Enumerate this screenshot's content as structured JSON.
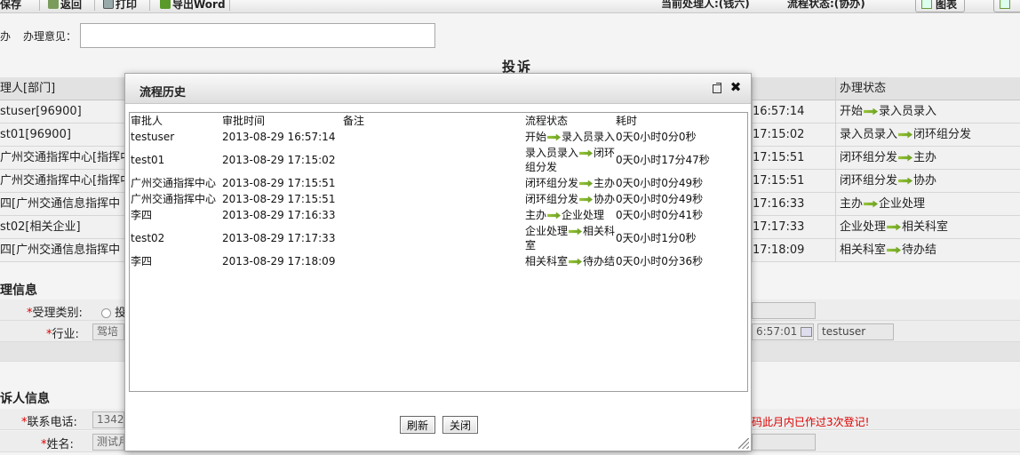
{
  "toolbar": {
    "save": "保存",
    "back": "返回",
    "print": "打印",
    "export_word": "导出Word",
    "current_handler": "当前处理人:(钱六)",
    "flow_status": "流程状态:(协办)",
    "chart": "图表"
  },
  "opinion": {
    "prefix": "办",
    "label": "办理意见："
  },
  "page_heading": "投诉",
  "bg_table": {
    "headers": [
      "理人[部门]",
      "",
      "办理状态"
    ],
    "rows": [
      {
        "handler": "stuser[96900]",
        "time": "16:57:14",
        "from": "开始",
        "to": "录入员录入"
      },
      {
        "handler": "st01[96900]",
        "time": "17:15:02",
        "from": "录入员录入",
        "to": "闭环组分发"
      },
      {
        "handler": "广州交通指挥中心[指挥中",
        "time": "17:15:51",
        "from": "闭环组分发",
        "to": "主办"
      },
      {
        "handler": "广州交通指挥中心[指挥中",
        "time": "17:15:51",
        "from": "闭环组分发",
        "to": "协办"
      },
      {
        "handler": "四[广州交通信息指挥中",
        "time": "17:16:33",
        "from": "主办",
        "to": "企业处理"
      },
      {
        "handler": "st02[相关企业]",
        "time": "17:17:33",
        "from": "企业处理",
        "to": "相关科室"
      },
      {
        "handler": "四[广州交通信息指挥中",
        "time": "17:18:09",
        "from": "相关科室",
        "to": "待办结"
      }
    ]
  },
  "accept_info": {
    "title": "理信息",
    "category_label": "受理类别:",
    "category_value": "投",
    "industry_label": "行业:",
    "industry_value": "驾培",
    "time_value": "6:57:01",
    "registrar_value": "testuser"
  },
  "complainant": {
    "title": "诉人信息",
    "phone_label": "联系电话:",
    "phone_value": "13422",
    "phone_warning": "码此月内已作过3次登记!",
    "name_label": "姓名:",
    "name_value": "测试月"
  },
  "dialog": {
    "title": "流程历史",
    "columns": [
      "审批人",
      "审批时间",
      "备注",
      "流程状态",
      "耗时"
    ],
    "rows": [
      {
        "approver": "testuser",
        "time": "2013-08-29 16:57:14",
        "remark": "",
        "from": "开始",
        "to": "录入员录入",
        "duration": "0天0小时0分0秒"
      },
      {
        "approver": "test01",
        "time": "2013-08-29 17:15:02",
        "remark": "",
        "from": "录入员录入",
        "to": "闭环组分发",
        "duration": "0天0小时17分47秒"
      },
      {
        "approver": "广州交通指挥中心",
        "time": "2013-08-29 17:15:51",
        "remark": "",
        "from": "闭环组分发",
        "to": "主办",
        "duration": "0天0小时0分49秒"
      },
      {
        "approver": "广州交通指挥中心",
        "time": "2013-08-29 17:15:51",
        "remark": "",
        "from": "闭环组分发",
        "to": "协办",
        "duration": "0天0小时0分49秒"
      },
      {
        "approver": "李四",
        "time": "2013-08-29 17:16:33",
        "remark": "",
        "from": "主办",
        "to": "企业处理",
        "duration": "0天0小时0分41秒"
      },
      {
        "approver": "test02",
        "time": "2013-08-29 17:17:33",
        "remark": "",
        "from": "企业处理",
        "to": "相关科室",
        "duration": "0天0小时1分0秒"
      },
      {
        "approver": "李四",
        "time": "2013-08-29 17:18:09",
        "remark": "",
        "from": "相关科室",
        "to": "待办结",
        "duration": "0天0小时0分36秒"
      }
    ],
    "refresh": "刷新",
    "close": "关闭"
  },
  "icons": {
    "status_arrow": "right-arrow-icon",
    "status_arrow_color": "#7fb22e",
    "maximize": "maximize-icon",
    "close": "close-icon"
  }
}
